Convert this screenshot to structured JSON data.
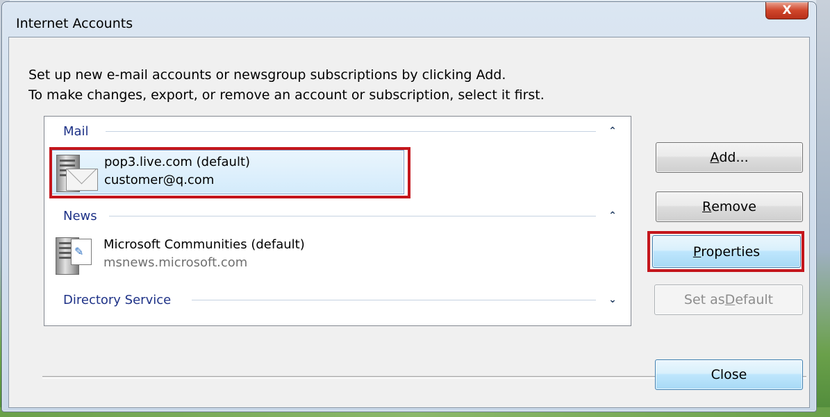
{
  "window": {
    "title": "Internet Accounts",
    "close_glyph": "X"
  },
  "intro": {
    "line1": "Set up new e-mail accounts or newsgroup subscriptions by clicking Add.",
    "line2": "To make changes, export, or remove an account or subscription, select it first."
  },
  "groups": {
    "mail": {
      "label": "Mail",
      "chevron": "⌃",
      "items": [
        {
          "name": "pop3.live.com (default)",
          "detail": "customer@q.com",
          "icon": "mail-server-icon",
          "selected": true
        }
      ]
    },
    "news": {
      "label": "News",
      "chevron": "⌃",
      "items": [
        {
          "name": "Microsoft Communities (default)",
          "detail": "msnews.microsoft.com",
          "icon": "news-server-icon",
          "selected": false
        }
      ]
    },
    "directory": {
      "label": "Directory Service",
      "chevron": "⌄"
    }
  },
  "buttons": {
    "add": {
      "pre": "",
      "accel": "A",
      "post": "dd..."
    },
    "remove": {
      "pre": "",
      "accel": "R",
      "post": "emove"
    },
    "properties": {
      "pre": "",
      "accel": "P",
      "post": "roperties"
    },
    "set_default": {
      "pre": "Set as ",
      "accel": "D",
      "post": "efault"
    },
    "close": {
      "label": "Close"
    }
  },
  "colors": {
    "highlight": "#c4161c",
    "group_header": "#1e3287"
  }
}
